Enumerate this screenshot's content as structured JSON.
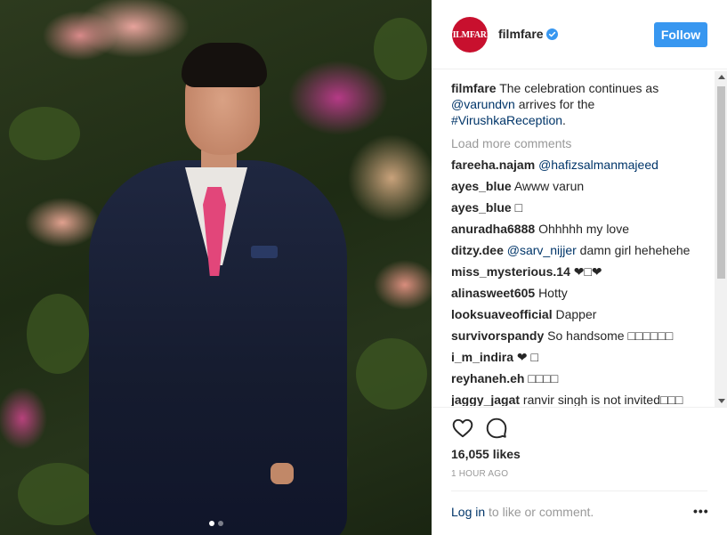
{
  "post": {
    "image_alt": "Man in navy suit with pink tie in front of floral wall",
    "carousel": {
      "count": 2,
      "active_index": 0
    }
  },
  "header": {
    "avatar_text": "FILMFARE",
    "username": "filmfare",
    "verified": true,
    "follow_label": "Follow",
    "accent_color": "#3897f0"
  },
  "caption": {
    "user": "filmfare",
    "text_before": "The celebration continues as ",
    "mention": "@varundvn",
    "text_middle": " arrives for the ",
    "hashtag": "#VirushkaReception",
    "text_after": "."
  },
  "load_more": "Load more comments",
  "comments": [
    {
      "user": "fareeha.najam",
      "mention": "@hafizsalmanmajeed",
      "text": ""
    },
    {
      "user": "ayes_blue",
      "mention": "",
      "text": "Awww varun"
    },
    {
      "user": "ayes_blue",
      "mention": "",
      "text": "□"
    },
    {
      "user": "anuradha6888",
      "mention": "",
      "text": "Ohhhhh my love"
    },
    {
      "user": "ditzy.dee",
      "mention": "@sarv_nijjer",
      "text": " damn girl hehehehe"
    },
    {
      "user": "miss_mysterious.14",
      "mention": "",
      "text": "❤□❤"
    },
    {
      "user": "alinasweet605",
      "mention": "",
      "text": "Hotty"
    },
    {
      "user": "looksuaveofficial",
      "mention": "",
      "text": "Dapper"
    },
    {
      "user": "survivorspandy",
      "mention": "",
      "text": "So handsome □□□□□□"
    },
    {
      "user": "i_m_indira",
      "mention": "",
      "text": "❤ □"
    },
    {
      "user": "reyhaneh.eh",
      "mention": "",
      "text": "□□□□"
    },
    {
      "user": "jaggy_jagat",
      "mention": "",
      "text": "ranvir singh is not invited□□□"
    }
  ],
  "actions": {
    "like_icon": "heart-icon",
    "comment_icon": "comment-icon"
  },
  "likes": "16,055 likes",
  "time": "1 HOUR AGO",
  "footer": {
    "login_link": "Log in",
    "login_text": " to like or comment.",
    "more_label": "•••"
  }
}
